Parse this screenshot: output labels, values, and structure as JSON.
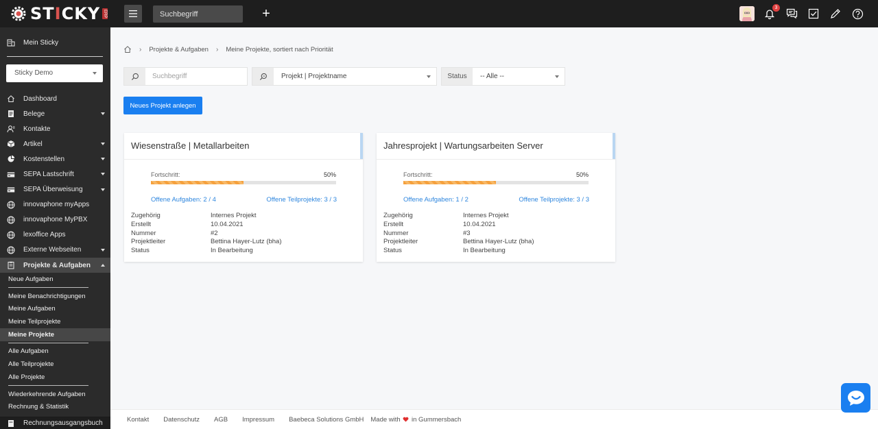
{
  "topbar": {
    "logo_text_left": "ST",
    "logo_text_mid": "I",
    "logo_text_right": "CKY",
    "logo_sub": "ERP",
    "search_placeholder": "Suchbegriff",
    "notification_count": "3",
    "icons": [
      "menu-icon",
      "plus-icon",
      "bell-icon",
      "chat-icon",
      "checkbox-icon",
      "pencil-icon",
      "help-icon"
    ]
  },
  "sidebar": {
    "header": "Mein Sticky",
    "company_select": "Sticky Demo",
    "items": [
      {
        "label": "Dashboard",
        "icon": "home-icon"
      },
      {
        "label": "Belege",
        "icon": "document-icon"
      },
      {
        "label": "Kontakte",
        "icon": "contacts-icon"
      },
      {
        "label": "Artikel",
        "icon": "box-icon"
      },
      {
        "label": "Kostenstellen",
        "icon": "pie-icon"
      },
      {
        "label": "SEPA Lastschrift",
        "icon": "card-icon"
      },
      {
        "label": "SEPA Überweisung",
        "icon": "card-icon"
      },
      {
        "label": "innovaphone myApps",
        "icon": "globe-icon"
      },
      {
        "label": "innovaphone MyPBX",
        "icon": "globe-icon"
      },
      {
        "label": "lexoffice Apps",
        "icon": "globe-icon"
      },
      {
        "label": "Externe Webseiten",
        "icon": "globe-icon"
      },
      {
        "label": "Projekte & Aufgaben",
        "icon": "clipboard-icon"
      }
    ],
    "sub_items": [
      "Neue Aufgaben",
      "Meine Benachrichtigungen",
      "Meine Aufgaben",
      "Meine Teilprojekte",
      "Meine Projekte",
      "Alle Aufgaben",
      "Alle Teilprojekte",
      "Alle Projekte",
      "Wiederkehrende Aufgaben",
      "Rechnung & Statistik"
    ],
    "bottom_item": "Rechnungsausgangsbuch"
  },
  "breadcrumb": {
    "items": [
      "Projekte & Aufgaben",
      "Meine Projekte, sortiert nach Priorität"
    ]
  },
  "filters": {
    "search_placeholder": "Suchbegriff",
    "field_select": "Projekt | Projektname",
    "status_label": "Status",
    "status_select": "-- Alle --"
  },
  "new_project_button": "Neues Projekt anlegen",
  "projects": [
    {
      "title": "Wiesenstraße | Metallarbeiten",
      "progress_label": "Fortschritt:",
      "progress": "50%",
      "progress_fraction": 0.5,
      "open_tasks": "Offene Aufgaben: 2 / 4",
      "open_subprojects": "Offene Teilprojekte: 3 / 3",
      "meta": [
        {
          "k": "Zugehörig",
          "v": "Internes Projekt"
        },
        {
          "k": "Erstellt",
          "v": "10.04.2021"
        },
        {
          "k": "Nummer",
          "v": "#2"
        },
        {
          "k": "Projektleiter",
          "v": "Bettina Hayer-Lutz (bha)"
        },
        {
          "k": "Status",
          "v": "In Bearbeitung"
        }
      ]
    },
    {
      "title": "Jahresprojekt | Wartungsarbeiten Server",
      "progress_label": "Fortschritt:",
      "progress": "50%",
      "progress_fraction": 0.5,
      "open_tasks": "Offene Aufgaben: 1 / 2",
      "open_subprojects": "Offene Teilprojekte: 3 / 3",
      "meta": [
        {
          "k": "Zugehörig",
          "v": "Internes Projekt"
        },
        {
          "k": "Erstellt",
          "v": "10.04.2021"
        },
        {
          "k": "Nummer",
          "v": "#3"
        },
        {
          "k": "Projektleiter",
          "v": "Bettina Hayer-Lutz (bha)"
        },
        {
          "k": "Status",
          "v": "In Bearbeitung"
        }
      ]
    }
  ],
  "footer": {
    "links": [
      "Kontakt",
      "Datenschutz",
      "AGB",
      "Impressum",
      "Baebeca Solutions GmbH"
    ],
    "made_pre": "Made with",
    "made_post": "in Gummersbach"
  },
  "colors": {
    "accent": "#1a7ff0",
    "progress": "#f5a03c",
    "sidebar": "#2b2b2b",
    "topbar": "#1e1e1e",
    "heart": "#e03030"
  }
}
